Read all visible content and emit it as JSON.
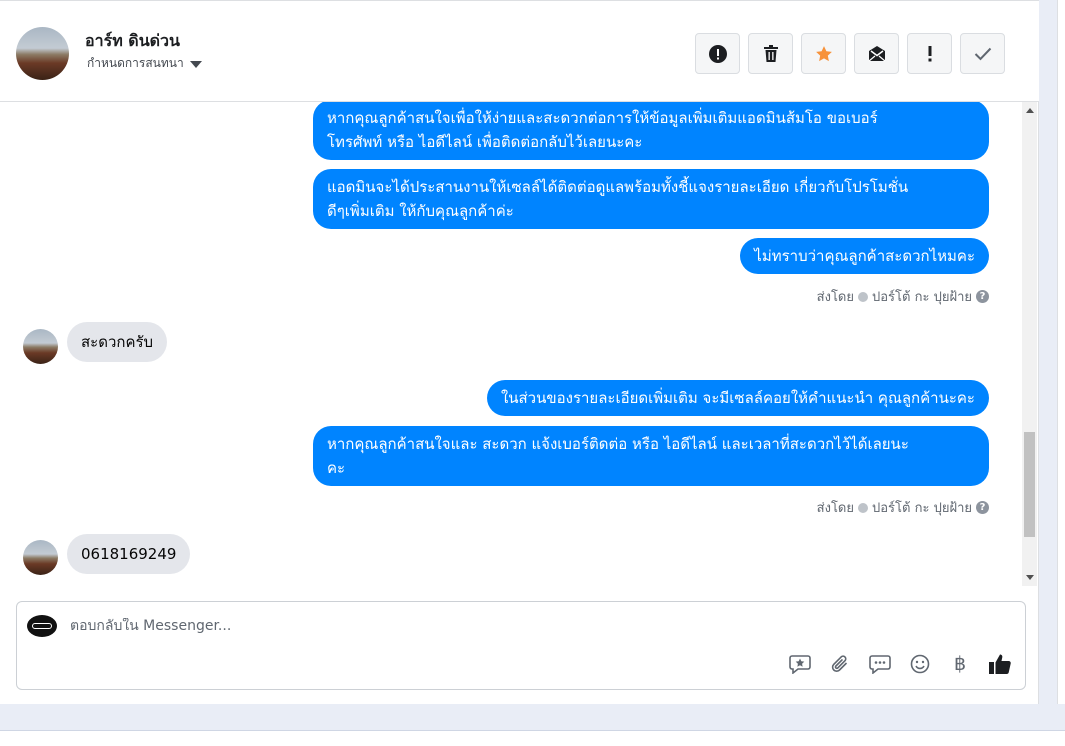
{
  "header": {
    "name": "อาร์ท ดินด่วน",
    "subtitle": "กำหนดการสนทนา",
    "actions": [
      {
        "icon": "alert-circle-icon",
        "name": "report-button"
      },
      {
        "icon": "trash-icon",
        "name": "delete-button"
      },
      {
        "icon": "star-icon",
        "name": "star-button"
      },
      {
        "icon": "mail-icon",
        "name": "mark-unread-button"
      },
      {
        "icon": "exclamation-icon",
        "name": "spam-button"
      },
      {
        "icon": "check-icon",
        "name": "done-button"
      }
    ],
    "star_color": "#f7923a"
  },
  "messages": {
    "m1": "หากคุณลูกค้าสนใจเพื่อให้ง่ายและสะดวกต่อการให้ข้อมูลเพิ่มเติมแอดมินส้มโอ ขอเบอร์โทรศัพท์ หรือ ไอดีไลน์ เพื่อติดต่อกลับไว้เลยนะคะ",
    "m1_line1": "หากคุณลูกค้าสนใจเพื่อให้ง่ายและสะดวกต่อการให้ข้อมูลเพิ่มเติมแอดมินส้มโอ ขอเบอร์",
    "m1_line2": "โทรศัพท์ หรือ ไอดีไลน์ เพื่อติดต่อกลับไว้เลยนะคะ",
    "m2_line1": "แอดมินจะได้ประสานงานให้เซลล์ได้ติดต่อดูแลพร้อมทั้งชี้แจงรายละเอียด เกี่ยวกับโปรโมชั่น",
    "m2_line2": "ดีๆเพิ่มเติม ให้กับคุณลูกค้าค่ะ",
    "m3": "ไม่ทราบว่าคุณลูกค้าสะดวกไหมคะ",
    "sent_by_1": "ส่งโดย",
    "sender_1": "ปอร์โต้ กะ ปุยฝ้าย",
    "m4": "สะดวกครับ",
    "m5": "ในส่วนของรายละเอียดเพิ่มเติม จะมีเซลล์คอยให้คำแนะนำ คุณลูกค้านะคะ",
    "m6_line1": "หากคุณลูกค้าสนใจและ สะดวก แจ้งเบอร์ติดต่อ หรือ ไอดีไลน์ และเวลาที่สะดวกไว้ได้เลยนะ",
    "m6_line2": "คะ",
    "sent_by_2": "ส่งโดย",
    "sender_2": "ปอร์โต้ กะ ปุยฝ้าย",
    "m7": "0618169249"
  },
  "composer": {
    "placeholder": "ตอบกลับใน Messenger...",
    "tools": [
      "saved-reply-icon",
      "attach-icon",
      "chat-icon",
      "emoji-icon",
      "baht-icon",
      "like-icon"
    ],
    "baht_symbol": "฿"
  },
  "colors": {
    "outgoing_bubble": "#0084ff",
    "incoming_bubble": "#e4e6eb"
  }
}
